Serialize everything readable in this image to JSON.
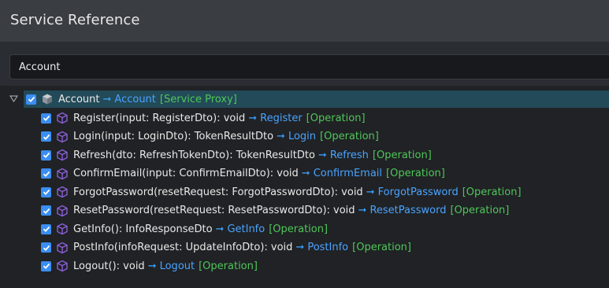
{
  "header": {
    "title": "Service Reference"
  },
  "filter": {
    "value": "Account"
  },
  "tree": {
    "root": {
      "label": "Account",
      "target": "Account",
      "kind": "[Service Proxy]",
      "checked": true,
      "expanded": true,
      "icon": "service-proxy-cube-icon"
    },
    "items": [
      {
        "label": "Register(input: RegisterDto): void",
        "target": "Register",
        "kind": "[Operation]",
        "checked": true,
        "icon": "operation-cube-icon"
      },
      {
        "label": "Login(input: LoginDto): TokenResultDto",
        "target": "Login",
        "kind": "[Operation]",
        "checked": true,
        "icon": "operation-cube-icon"
      },
      {
        "label": "Refresh(dto: RefreshTokenDto): TokenResultDto",
        "target": "Refresh",
        "kind": "[Operation]",
        "checked": true,
        "icon": "operation-cube-icon"
      },
      {
        "label": "ConfirmEmail(input: ConfirmEmailDto): void",
        "target": "ConfirmEmail",
        "kind": "[Operation]",
        "checked": true,
        "icon": "operation-cube-icon"
      },
      {
        "label": "ForgotPassword(resetRequest: ForgotPasswordDto): void",
        "target": "ForgotPassword",
        "kind": "[Operation]",
        "checked": true,
        "icon": "operation-cube-icon"
      },
      {
        "label": "ResetPassword(resetRequest: ResetPasswordDto): void",
        "target": "ResetPassword",
        "kind": "[Operation]",
        "checked": true,
        "icon": "operation-cube-icon"
      },
      {
        "label": "GetInfo(): InfoResponseDto",
        "target": "GetInfo",
        "kind": "[Operation]",
        "checked": true,
        "icon": "operation-cube-icon"
      },
      {
        "label": "PostInfo(infoRequest: UpdateInfoDto): void",
        "target": "PostInfo",
        "kind": "[Operation]",
        "checked": true,
        "icon": "operation-cube-icon"
      },
      {
        "label": "Logout(): void",
        "target": "Logout",
        "kind": "[Operation]",
        "checked": true,
        "icon": "operation-cube-icon"
      }
    ]
  },
  "colors": {
    "checkbox": "#3b8ef1",
    "arrow": "#3b9cf5",
    "target": "#4aa3ff",
    "kind": "#4fc65a",
    "selected_row": "#234a58",
    "operation_icon": "#8a5fd8",
    "proxy_icon": "#9aa3ad"
  }
}
